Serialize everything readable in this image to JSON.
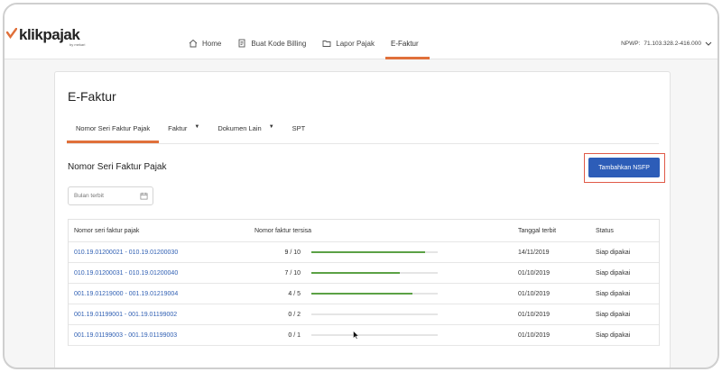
{
  "brand": {
    "name": "klikpajak",
    "tagline": "by mekari",
    "accent": "#e0703a"
  },
  "nav": {
    "items": [
      {
        "label": "Home",
        "icon": "home-icon",
        "active": false
      },
      {
        "label": "Buat Kode Billing",
        "icon": "document-icon",
        "active": false
      },
      {
        "label": "Lapor Pajak",
        "icon": "folder-icon",
        "active": false
      },
      {
        "label": "E-Faktur",
        "icon": "",
        "active": true
      }
    ],
    "npwp_label": "NPWP:",
    "npwp_value": "71.103.328.2-416.000"
  },
  "page": {
    "title": "E-Faktur",
    "tabs": [
      {
        "label": "Nomor Seri Faktur Pajak",
        "dropdown": false,
        "active": true
      },
      {
        "label": "Faktur",
        "dropdown": true,
        "active": false
      },
      {
        "label": "Dokumen Lain",
        "dropdown": true,
        "active": false
      },
      {
        "label": "SPT",
        "dropdown": false,
        "active": false
      }
    ],
    "section_title": "Nomor Seri Faktur Pajak",
    "add_button_label": "Tambahkan NSFP",
    "add_button_color": "#2d5db8",
    "date_filter_placeholder": "Bulan terbit"
  },
  "table": {
    "headers": [
      "Nomor seri faktur pajak",
      "Nomor faktur tersisa",
      "Tanggal terbit",
      "Status"
    ],
    "rows": [
      {
        "range": "010.19.01200021 - 010.19.01200030",
        "remaining": "9",
        "total": "/ 10",
        "fill": 0.9,
        "date": "14/11/2019",
        "status": "Siap dipakai"
      },
      {
        "range": "010.19.01200031 - 010.19.01200040",
        "remaining": "7",
        "total": "/ 10",
        "fill": 0.7,
        "date": "01/10/2019",
        "status": "Siap dipakai"
      },
      {
        "range": "001.19.01219000 - 001.19.01219004",
        "remaining": "4",
        "total": "/ 5",
        "fill": 0.8,
        "date": "01/10/2019",
        "status": "Siap dipakai"
      },
      {
        "range": "001.19.01199001 - 001.19.01199002",
        "remaining": "0",
        "total": "/ 2",
        "fill": 0,
        "date": "01/10/2019",
        "status": "Siap dipakai"
      },
      {
        "range": "001.19.01199003 - 001.19.01199003",
        "remaining": "0",
        "total": "/ 1",
        "fill": 0,
        "date": "01/10/2019",
        "status": "Siap dipakai"
      }
    ]
  }
}
